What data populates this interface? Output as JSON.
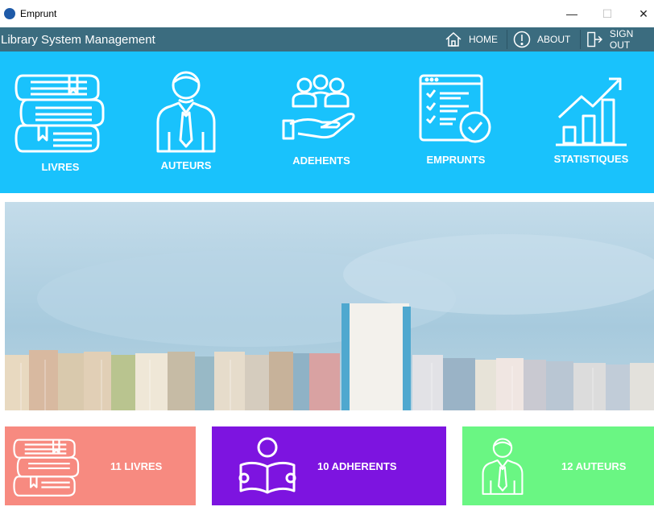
{
  "window": {
    "title": "Emprunt",
    "min": "—",
    "max": "☐",
    "close": "✕"
  },
  "menubar": {
    "title": "Library System Management",
    "home": "HOME",
    "about": "ABOUT",
    "signout": "SIGN OUT"
  },
  "nav": [
    {
      "label": "LIVRES",
      "icon": "books-icon"
    },
    {
      "label": "AUTEURS",
      "icon": "author-icon"
    },
    {
      "label": "ADEHENTS",
      "icon": "members-icon"
    },
    {
      "label": "EMPRUNTS",
      "icon": "checklist-icon"
    },
    {
      "label": "STATISTIQUES",
      "icon": "statistics-icon"
    }
  ],
  "stats": [
    {
      "label": "11 LIVRES",
      "color": "#f78a80",
      "icon": "books-icon"
    },
    {
      "label": "10 ADHERENTS",
      "color": "#7d14e0",
      "icon": "reader-icon"
    },
    {
      "label": "12 AUTEURS",
      "color": "#6af683",
      "icon": "author-icon"
    }
  ],
  "colors": {
    "menubar": "#3b6c7f",
    "nav": "#19c2fc"
  }
}
